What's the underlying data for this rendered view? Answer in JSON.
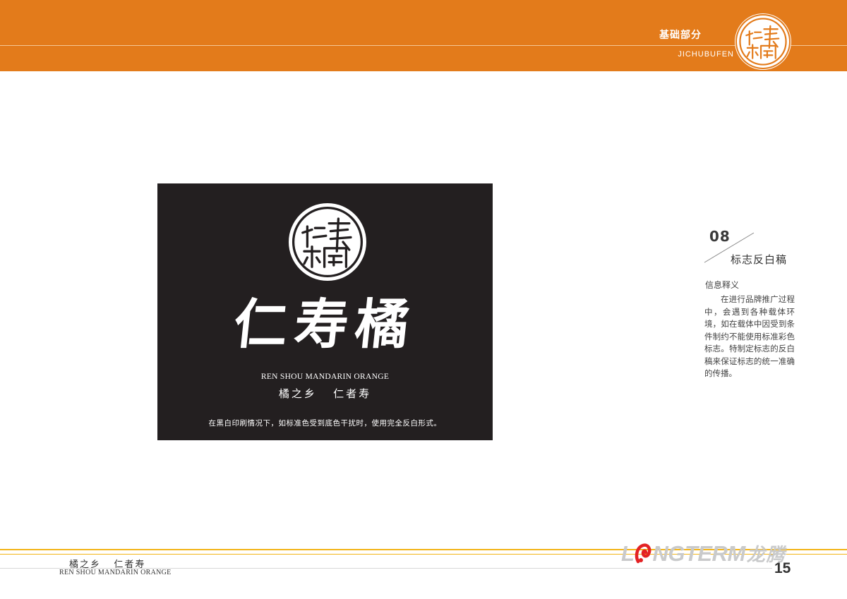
{
  "header": {
    "section_title": "基础部分",
    "section_subtitle": "JICHUBUFEN",
    "seal_icon": "seal-logo-icon"
  },
  "panel": {
    "brand_name": "仁寿橘",
    "brand_name_en": "REN SHOU MANDARIN ORANGE",
    "slogan": "橘之乡   仁者寿",
    "note": "在黑白印刷情况下，如标准色受到底色干扰时，使用完全反白形式。"
  },
  "info": {
    "item_number": "08",
    "item_title": "标志反白稿",
    "heading": "信息释义",
    "body": "在进行品牌推广过程中，会遇到各种载体环境，如在载体中因受到条件制约不能使用标准彩色标志。特制定标志的反白稿来保证标志的统一准确的传播。"
  },
  "footer": {
    "slogan": "橘之乡   仁者寿",
    "slogan_en": "REN SHOU  MANDARIN ORANGE",
    "company_logo_prefix": "L",
    "company_logo_suffix": "NGTERM",
    "company_logo_cn": "龙腾",
    "company_mark_icon": "red-dragon-mark-icon",
    "page_number": "15"
  },
  "colors": {
    "header_orange": "#e37b1b",
    "panel_black": "#231f20",
    "footer_gold": "#f2b418",
    "logo_red": "#e32224",
    "logo_gray": "#c9cacb"
  }
}
